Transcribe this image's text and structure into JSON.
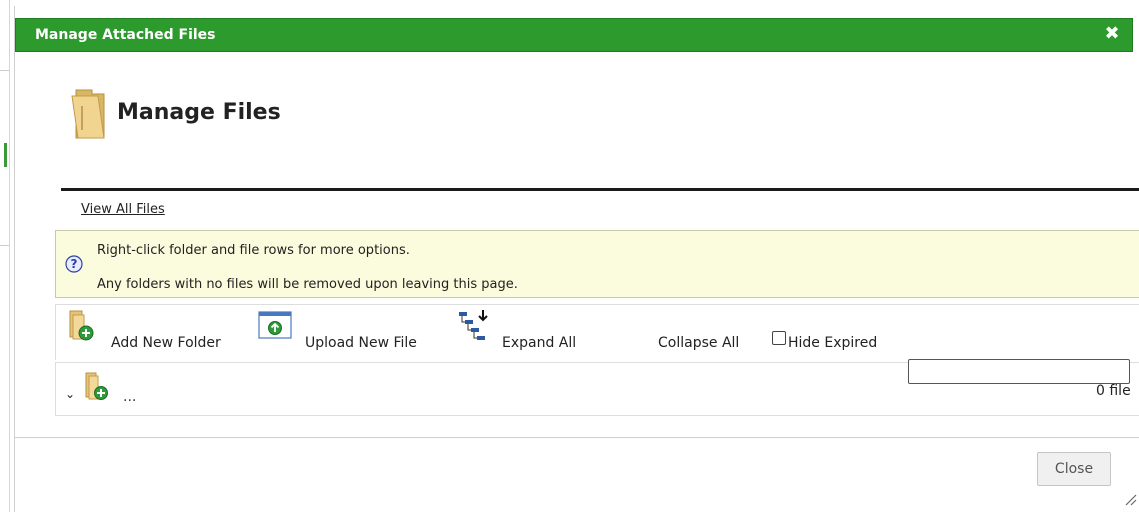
{
  "dialog": {
    "title": "Manage Attached Files",
    "close_glyph": "✖"
  },
  "header": {
    "icon": "folder-icon",
    "title": "Manage Files"
  },
  "links": {
    "view_all": "View All Files"
  },
  "info": {
    "icon": "question-icon",
    "line1": "Right-click folder and file rows for more options.",
    "line2": "Any folders with no files will be removed upon leaving this page."
  },
  "toolbar": {
    "add_folder": {
      "label": "Add New Folder",
      "icon": "folder-add-icon"
    },
    "upload_file": {
      "label": "Upload New File",
      "icon": "file-upload-icon"
    },
    "expand_all": {
      "label": "Expand All",
      "icon": "tree-expand-icon"
    },
    "collapse_all": {
      "label": "Collapse All"
    },
    "hide_expired": {
      "label": "Hide Expired",
      "checked": false
    }
  },
  "tree": {
    "chevron": "⌄",
    "root_label": "...",
    "search_value": "",
    "file_count": "0 file"
  },
  "footer": {
    "close_label": "Close"
  },
  "colors": {
    "titlebar": "#2c9a2c",
    "info_bg": "#fbfbdd",
    "folder": "#e6c27a"
  }
}
